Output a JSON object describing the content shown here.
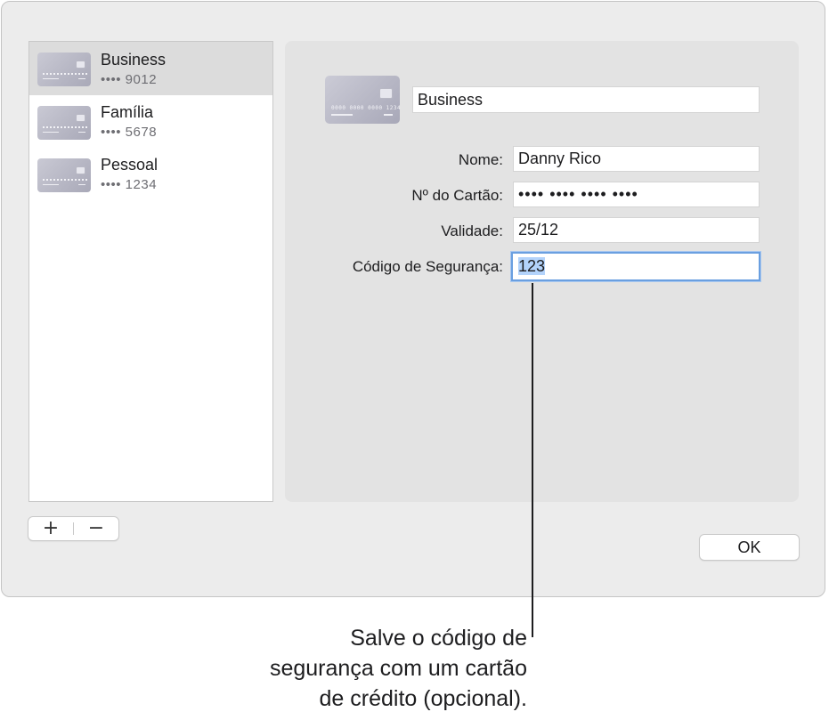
{
  "card_list": {
    "items": [
      {
        "name": "Business",
        "digits": "•••• 9012",
        "selected": true
      },
      {
        "name": "Família",
        "digits": "•••• 5678",
        "selected": false
      },
      {
        "name": "Pessoal",
        "digits": "•••• 1234",
        "selected": false
      }
    ]
  },
  "list_controls": {
    "add_label": "+",
    "remove_label": "−"
  },
  "detail": {
    "description_value": "Business",
    "card_thumb_number": "0000 0000 0000 1234",
    "fields": [
      {
        "label": "Nome:",
        "value": "Danny Rico"
      },
      {
        "label": "Nº do Cartão:",
        "value": "•••• •••• •••• ••••"
      },
      {
        "label": "Validade:",
        "value": "25/12"
      },
      {
        "label": "Código de Segurança:",
        "value": "123"
      }
    ]
  },
  "ok_label": "OK",
  "callout": {
    "line1": "Salve o código de",
    "line2": "segurança com um cartão",
    "line3": "de crédito (opcional)."
  },
  "colors": {
    "focus_ring": "#6a9fe0",
    "selection": "#b3d3fb",
    "selected_row": "#dcdcdc"
  }
}
